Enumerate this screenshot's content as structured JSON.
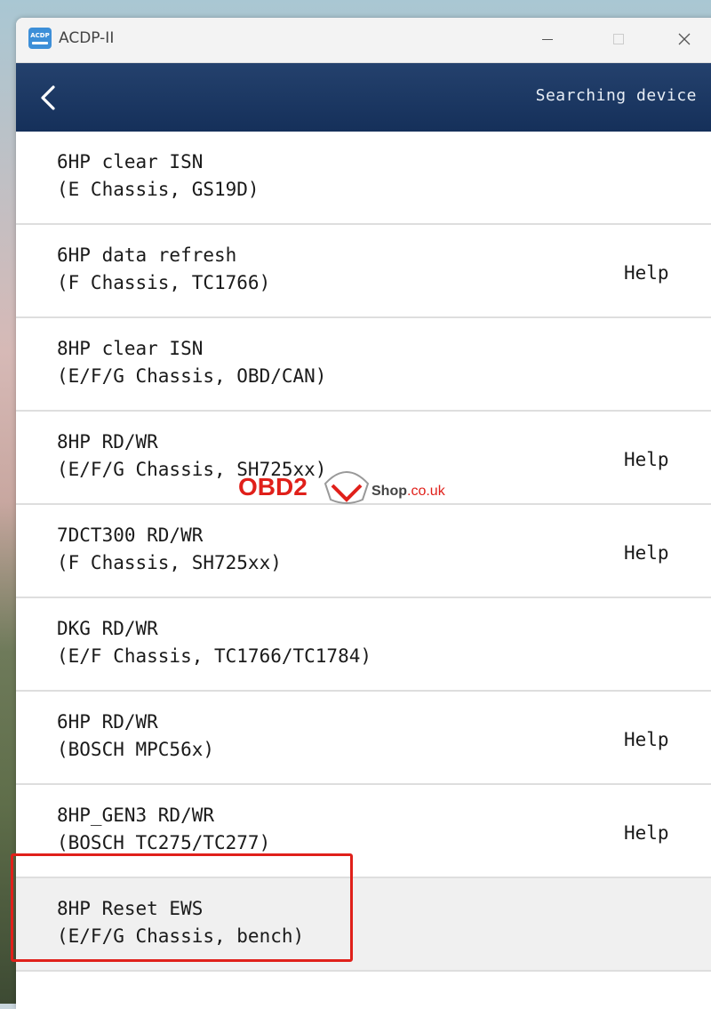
{
  "window": {
    "title": "ACDP-II",
    "icon_text": "ACDP"
  },
  "header": {
    "status": "Searching device"
  },
  "items": [
    {
      "title": "6HP clear ISN",
      "subtitle": "(E Chassis, GS19D)",
      "help": ""
    },
    {
      "title": "6HP data refresh",
      "subtitle": "(F Chassis, TC1766)",
      "help": "Help"
    },
    {
      "title": "8HP clear ISN",
      "subtitle": "(E/F/G Chassis, OBD/CAN)",
      "help": ""
    },
    {
      "title": "8HP RD/WR",
      "subtitle": "(E/F/G Chassis, SH725xx)",
      "help": "Help"
    },
    {
      "title": "7DCT300 RD/WR",
      "subtitle": "(F Chassis, SH725xx)",
      "help": "Help"
    },
    {
      "title": "DKG RD/WR",
      "subtitle": "(E/F Chassis, TC1766/TC1784)",
      "help": ""
    },
    {
      "title": "6HP RD/WR",
      "subtitle": "(BOSCH MPC56x)",
      "help": "Help"
    },
    {
      "title": "8HP_GEN3 RD/WR",
      "subtitle": "(BOSCH TC275/TC277)",
      "help": "Help"
    },
    {
      "title": "8HP Reset EWS",
      "subtitle": "(E/F/G Chassis, bench)",
      "help": ""
    }
  ],
  "watermark": {
    "brand": "OBD2",
    "shop": "Shop",
    "domain": ".co.uk"
  },
  "colors": {
    "header": "#1b365f",
    "highlight": "#e0201a",
    "selected_row": "#f0f0f0"
  }
}
